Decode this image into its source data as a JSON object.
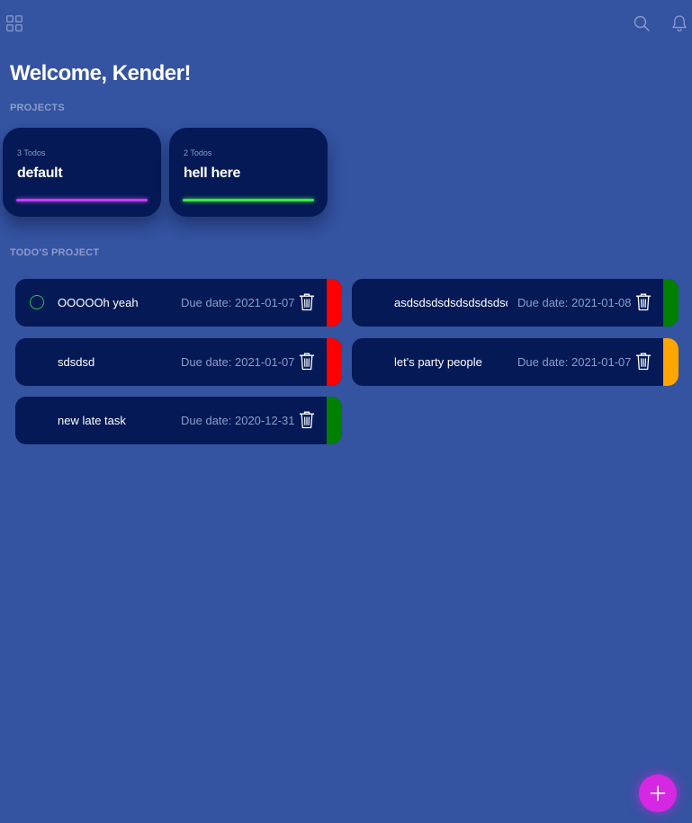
{
  "header": {
    "icons": [
      "grid-icon",
      "search-icon",
      "bell-icon"
    ],
    "welcome": "Welcome, Kender!"
  },
  "projects": {
    "label": "PROJECTS",
    "items": [
      {
        "count": "3 Todos",
        "name": "default",
        "color": "#c33ef0"
      },
      {
        "count": "2 Todos",
        "name": "hell here",
        "color": "#3ee63e"
      }
    ]
  },
  "todos": {
    "label": "TODO'S PROJECT",
    "items": [
      {
        "title": "OOOOOh yeah",
        "due": "Due date: 2021-01-07",
        "priority_color": "#ff0000",
        "has_check": true
      },
      {
        "title": "asdsdsdsdsdsdsdsdsd",
        "due": "Due date: 2021-01-08",
        "priority_color": "#008000",
        "has_check": false
      },
      {
        "title": "sdsdsd",
        "due": "Due date: 2021-01-07",
        "priority_color": "#ff0000",
        "has_check": false
      },
      {
        "title": "let's party people",
        "due": "Due date: 2021-01-07",
        "priority_color": "#ffa500",
        "has_check": false
      },
      {
        "title": "new late task",
        "due": "Due date: 2020-12-31",
        "priority_color": "#008000",
        "has_check": false
      }
    ]
  },
  "fab": {
    "icon": "plus-icon"
  },
  "colors": {
    "background": "#3453a1",
    "card": "#041955",
    "muted_text": "#8d9ccb",
    "fab": "#d627e3"
  }
}
